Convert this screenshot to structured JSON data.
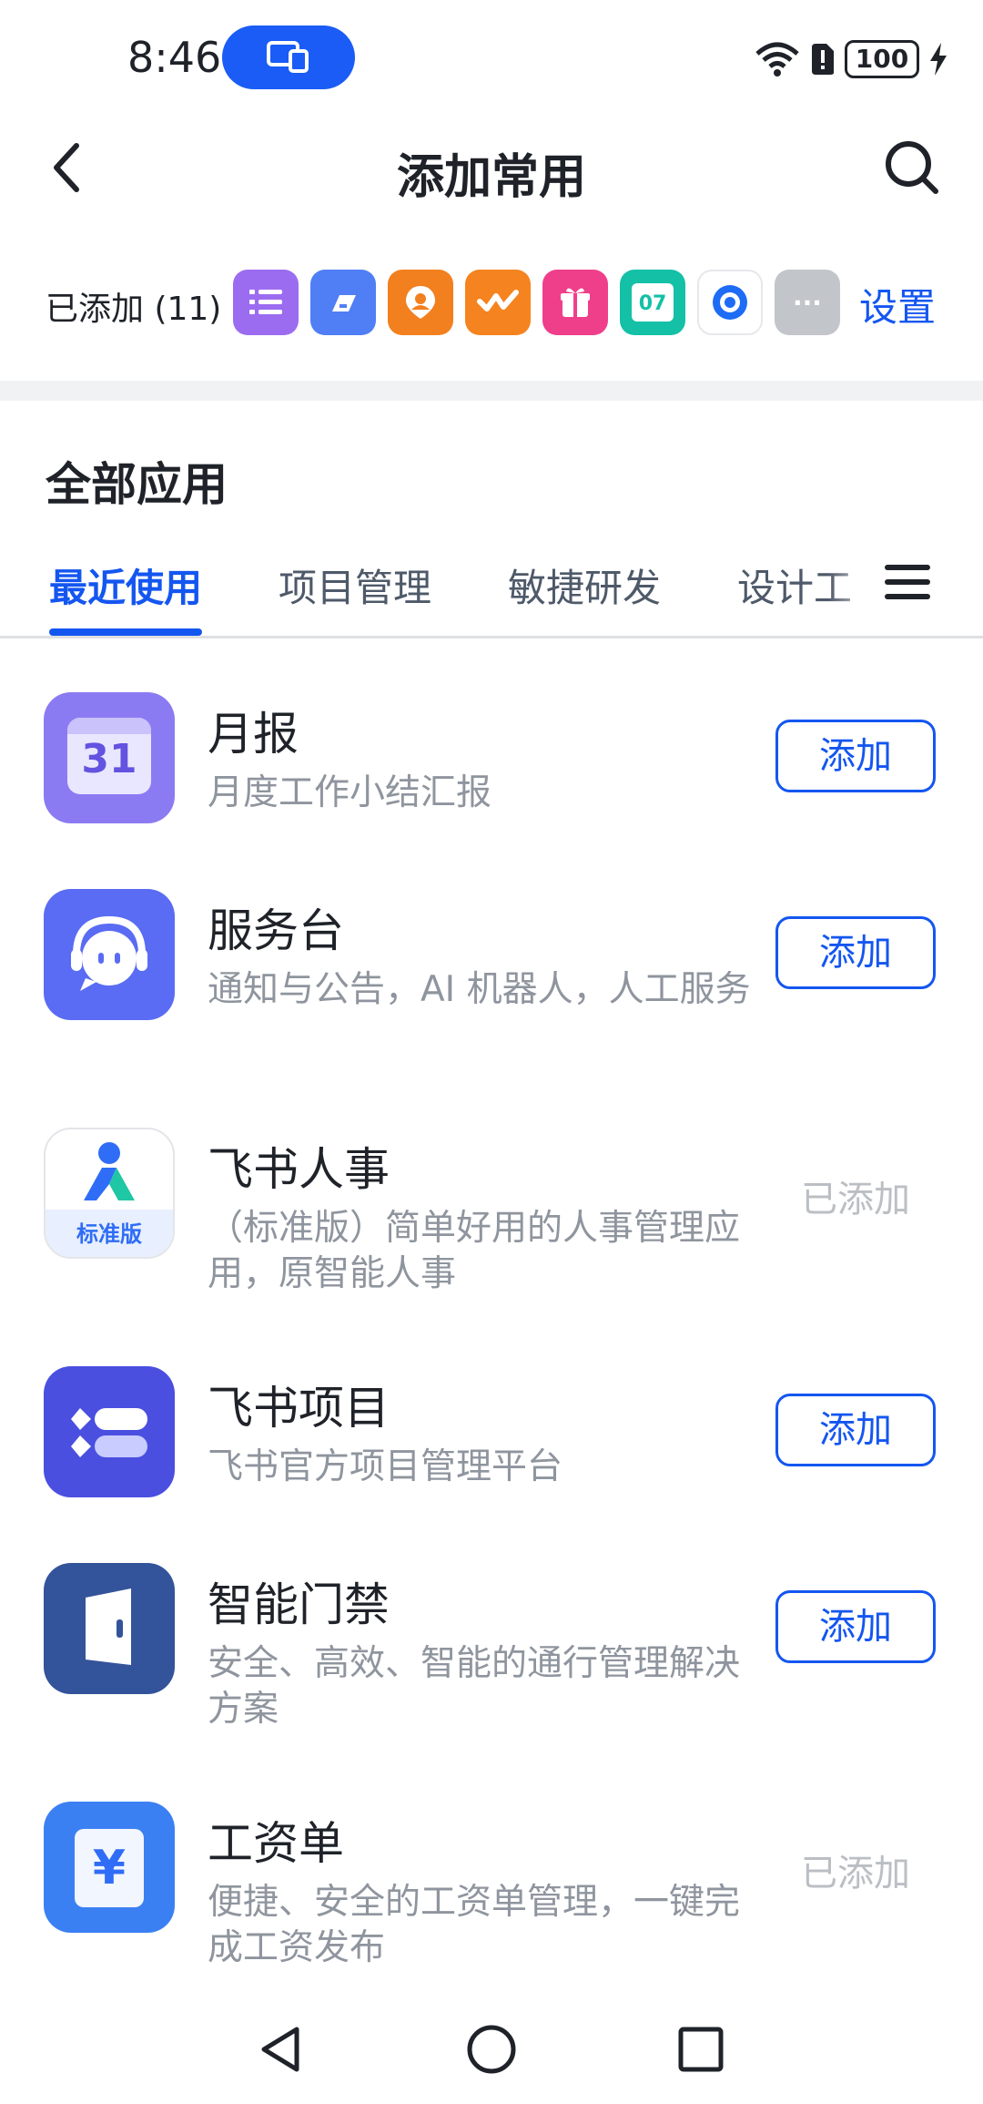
{
  "status_bar": {
    "time": "8:46",
    "battery": "100"
  },
  "header": {
    "title": "添加常用"
  },
  "added_bar": {
    "label": "已添加 (11)",
    "settings_label": "设置",
    "icons": [
      {
        "name": "list-app-icon",
        "color": "#9c6cf0"
      },
      {
        "name": "bookmark-app-icon",
        "color": "#4f7ef5"
      },
      {
        "name": "person-location-app-icon",
        "color": "#f2801f"
      },
      {
        "name": "check-wave-app-icon",
        "color": "#f5831f"
      },
      {
        "name": "gift-app-icon",
        "color": "#ef3f8b"
      },
      {
        "name": "calendar-app-icon",
        "color": "#14c0a6",
        "text": "07"
      },
      {
        "name": "circle-app-icon",
        "color": "#1e6cf5"
      },
      {
        "name": "more-icon",
        "color": "#c2c5ca",
        "text": "···"
      }
    ]
  },
  "section": {
    "title": "全部应用"
  },
  "tabs": [
    {
      "label": "最近使用",
      "active": true
    },
    {
      "label": "项目管理"
    },
    {
      "label": "敏捷研发"
    },
    {
      "label": "设计工"
    }
  ],
  "apps": [
    {
      "name": "月报",
      "desc": "月度工作小结汇报",
      "action": "添加",
      "added": false,
      "icon": "calendar-31-icon",
      "icon_text": "31"
    },
    {
      "name": "服务台",
      "desc": "通知与公告，AI 机器人，人工服务",
      "action": "添加",
      "added": false,
      "icon": "service-bot-icon"
    },
    {
      "name": "飞书人事",
      "desc": "（标准版）简单好用的人事管理应用，原智能人事",
      "action": "已添加",
      "added": true,
      "icon": "people-standard-icon",
      "icon_text": "标准版"
    },
    {
      "name": "飞书项目",
      "desc": "飞书官方项目管理平台",
      "action": "添加",
      "added": false,
      "icon": "project-icon"
    },
    {
      "name": "智能门禁",
      "desc": "安全、高效、智能的通行管理解决方案",
      "action": "添加",
      "added": false,
      "icon": "door-icon"
    },
    {
      "name": "工资单",
      "desc": "便捷、安全的工资单管理，一键完成工资发布",
      "action": "已添加",
      "added": true,
      "icon": "yuan-icon",
      "icon_text": "¥"
    }
  ]
}
